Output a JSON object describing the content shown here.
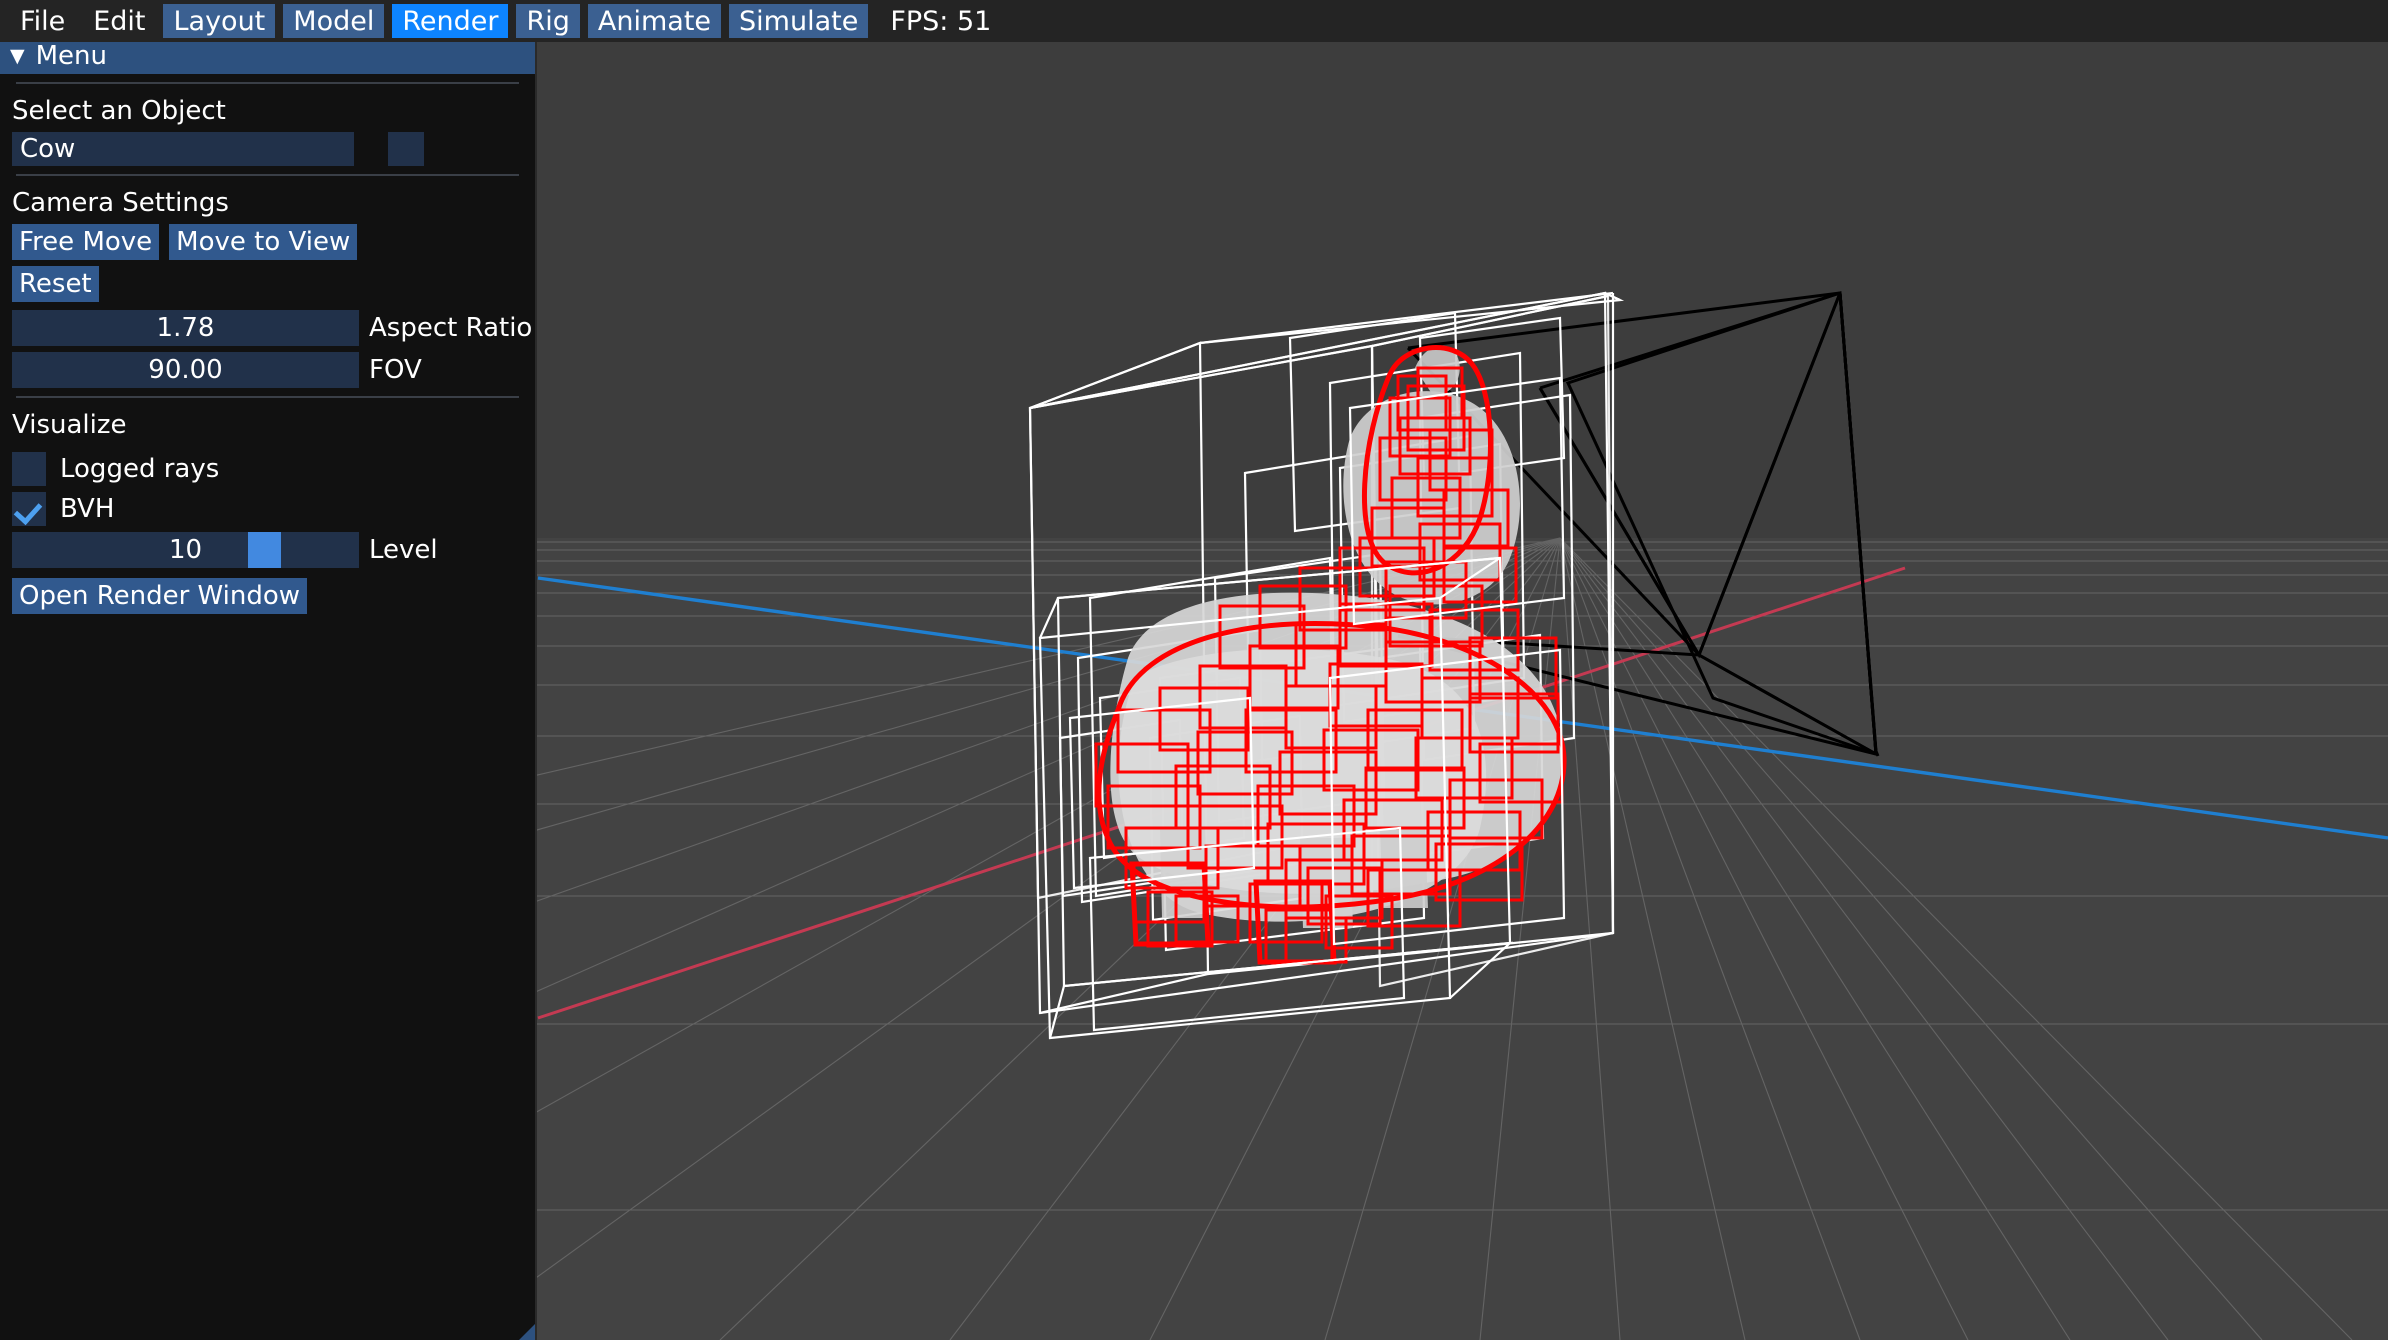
{
  "menubar": {
    "items": [
      {
        "label": "File",
        "style": "plain",
        "name": "menu-file"
      },
      {
        "label": "Edit",
        "style": "plain",
        "name": "menu-edit"
      },
      {
        "label": "Layout",
        "style": "tinted",
        "name": "menu-layout"
      },
      {
        "label": "Model",
        "style": "tinted",
        "name": "menu-model"
      },
      {
        "label": "Render",
        "style": "active",
        "name": "menu-render"
      },
      {
        "label": "Rig",
        "style": "tinted",
        "name": "menu-rig"
      },
      {
        "label": "Animate",
        "style": "tinted",
        "name": "menu-animate"
      },
      {
        "label": "Simulate",
        "style": "tinted",
        "name": "menu-simulate"
      }
    ],
    "fps_text": "FPS: 51",
    "active_color": "#0d84ff",
    "tinted_color": "#3b6091",
    "background": "#242424"
  },
  "panel": {
    "title": "Menu",
    "collapse_icon": "▼",
    "select_object": {
      "label": "Select an Object",
      "value": "Cow",
      "options": [
        "Cow"
      ]
    },
    "camera_settings": {
      "label": "Camera Settings",
      "buttons": [
        {
          "label": "Free Move",
          "name": "free-move-button"
        },
        {
          "label": "Move to View",
          "name": "move-to-view-button"
        },
        {
          "label": "Reset",
          "name": "reset-button"
        }
      ],
      "fields": [
        {
          "value": "1.78",
          "label": "Aspect Ratio",
          "name": "aspect-ratio-field"
        },
        {
          "value": "90.00",
          "label": "FOV",
          "name": "fov-field"
        }
      ]
    },
    "visualize": {
      "label": "Visualize",
      "checkboxes": [
        {
          "label": "Logged rays",
          "checked": false,
          "name": "logged-rays-checkbox"
        },
        {
          "label": "BVH",
          "checked": true,
          "name": "bvh-checkbox"
        }
      ],
      "level_slider": {
        "value": "10",
        "label": "Level",
        "handle_percent": 68
      },
      "open_render_window": "Open Render Window"
    },
    "accent_color": "#31598e",
    "field_color": "#21314a",
    "background": "#111111"
  },
  "viewport": {
    "background": "#3d3d3d",
    "grid_color": "#8e8e8e",
    "axis_x_color": "#1f7fd0",
    "axis_z_color": "#c43a52",
    "bvh_box_color": "#ffffff",
    "bvh_leaf_color": "#ff0000",
    "mesh_color": "#d8d8d8",
    "frustum_color": "#000000",
    "object_name": "Cow",
    "overlay_name": "bvh-wireframe"
  }
}
